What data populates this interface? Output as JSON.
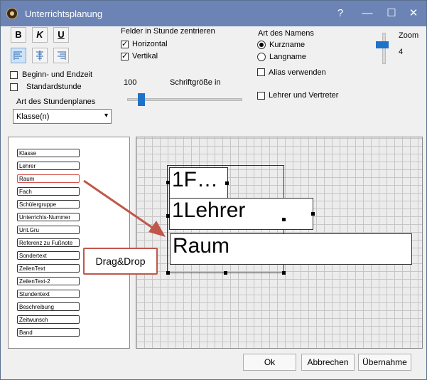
{
  "window": {
    "title": "Unterrichtsplanung"
  },
  "title_buttons": {
    "help": "?",
    "minimize": "—",
    "maximize": "☐",
    "close": "✕"
  },
  "format": {
    "bold": "B",
    "italic": "K",
    "underline": "U"
  },
  "center": {
    "heading": "Felder in Stunde zentrieren",
    "horizontal": {
      "label": "Horizontal",
      "checked": true
    },
    "vertical": {
      "label": "Vertikal",
      "checked": true
    }
  },
  "name_type": {
    "heading": "Art des Namens",
    "short": {
      "label": "Kurzname",
      "selected": true
    },
    "long": {
      "label": "Langname",
      "selected": false
    },
    "alias": {
      "label": "Alias verwenden",
      "checked": false
    },
    "teachers": {
      "label": "Lehrer und Vertreter",
      "checked": false
    }
  },
  "zoom": {
    "label": "Zoom",
    "value": "4"
  },
  "options": {
    "begin_end": {
      "label": "Beginn- und Endzeit",
      "checked": false
    },
    "standard_hour": {
      "label": "Standardstunde",
      "checked": false
    }
  },
  "font_size": {
    "label": "Schriftgröße in",
    "value": "100"
  },
  "plan_type": {
    "label": "Art des Stundenplanes",
    "value": "Klasse(n)"
  },
  "fields": [
    "Klasse",
    "Lehrer",
    "Raum",
    "Fach",
    "Schülergruppe",
    "Unterrichts-Nummer",
    "Unt.Gru",
    "Referenz zu Fußnote",
    "Sondertext",
    "ZeilenText",
    "ZeilenText-2",
    "Stundentext",
    "Beschreibung",
    "Zeitwunsch",
    "Band"
  ],
  "layout_cells": {
    "class": "1F…",
    "teacher": "1Lehrer",
    "room": "Raum"
  },
  "callout": "Drag&Drop",
  "buttons": {
    "ok": "Ok",
    "cancel": "Abbrechen",
    "apply": "Übernahme"
  },
  "colors": {
    "titlebar": "#6b84b5",
    "arrow": "#c0574a",
    "highlight": "#d9534f",
    "slider": "#1e73c8"
  }
}
